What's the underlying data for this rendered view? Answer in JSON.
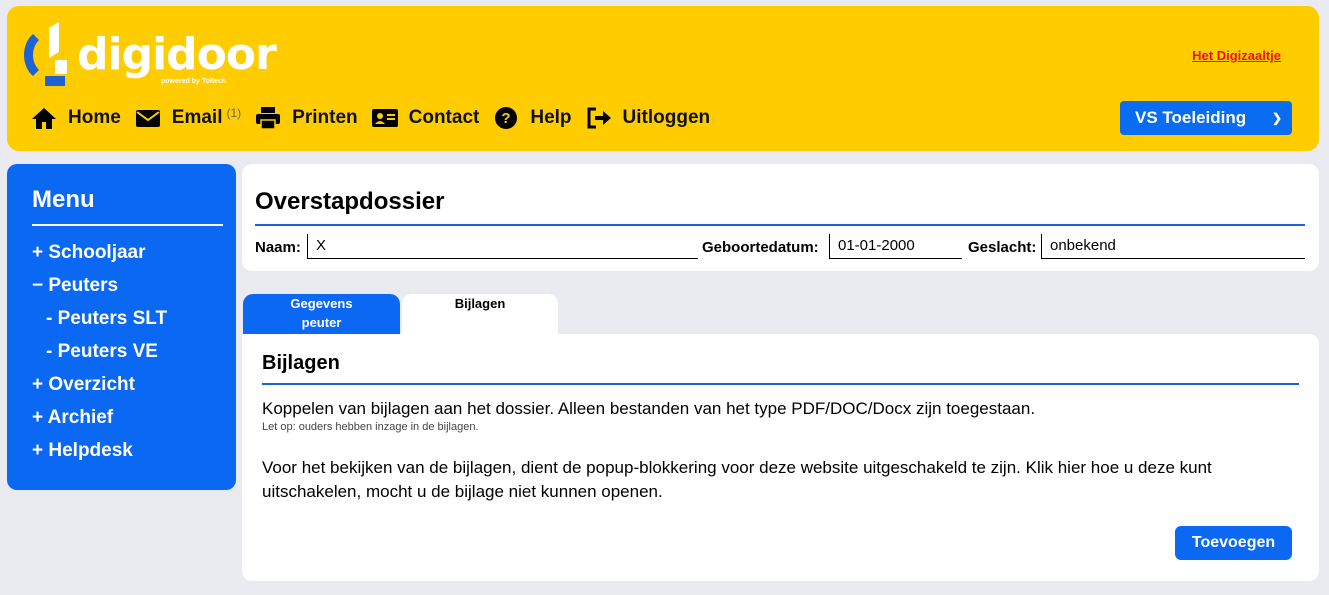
{
  "header": {
    "logo_text": "digidoor",
    "logo_sub": "powered by Toltech",
    "link": "Het Digizaaltje",
    "nav": [
      {
        "label": "Home",
        "icon": "home-icon"
      },
      {
        "label": "Email",
        "icon": "envelope-icon",
        "badge": "(1)"
      },
      {
        "label": "Printen",
        "icon": "printer-icon"
      },
      {
        "label": "Contact",
        "icon": "contact-card-icon"
      },
      {
        "label": "Help",
        "icon": "question-circle-icon"
      },
      {
        "label": "Uitloggen",
        "icon": "logout-icon"
      }
    ],
    "role_select": "VS Toeleiding"
  },
  "sidebar": {
    "title": "Menu",
    "items": [
      {
        "label": "+ Schooljaar"
      },
      {
        "label": "− Peuters"
      },
      {
        "label": "- Peuters SLT"
      },
      {
        "label": "- Peuters VE"
      },
      {
        "label": "+ Overzicht"
      },
      {
        "label": "+ Archief"
      },
      {
        "label": "+ Helpdesk"
      }
    ]
  },
  "dossier": {
    "title": "Overstapdossier",
    "name_label": "Naam:",
    "name_value": "X",
    "dob_label": "Geboortedatum:",
    "dob_value": "01-01-2000",
    "gender_label": "Geslacht:",
    "gender_value": "onbekend"
  },
  "tabs": [
    {
      "label_line1": "Gegevens",
      "label_line2": "peuter"
    },
    {
      "label_line1": "Bijlagen",
      "label_line2": ""
    }
  ],
  "content": {
    "title": "Bijlagen",
    "intro": "Koppelen van bijlagen aan het dossier. Alleen bestanden van het type PDF/DOC/Docx zijn toegestaan.",
    "note": "Let op: ouders hebben inzage in de bijlagen.",
    "popup_text": "Voor het bekijken van de bijlagen, dient de popup-blokkering voor deze website uitgeschakeld te zijn. Klik hier hoe u deze kunt uitschakelen, mocht u de bijlage niet kunnen openen.",
    "add_button": "Toevoegen"
  },
  "colors": {
    "header_bg": "#ffcc00",
    "primary_blue": "#0b68f2",
    "link_red": "#e8150d"
  }
}
